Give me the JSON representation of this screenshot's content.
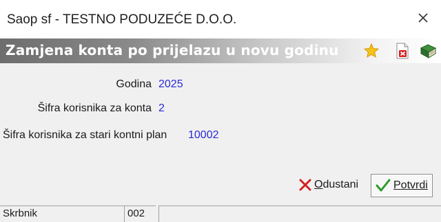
{
  "window": {
    "title": "Saop sf - TESTNO PODUZEĆE D.O.O.",
    "close_icon": "close-icon"
  },
  "header": {
    "title": "Zamjena konta po prijelazu u novu godinu",
    "icons": [
      "star-icon",
      "delete-document-icon",
      "book-icon"
    ]
  },
  "form": {
    "fields": [
      {
        "label": "Godina",
        "value": "2025"
      },
      {
        "label": "Šifra korisnika za konta",
        "value": "2"
      },
      {
        "label": "Šifra korisnika za stari kontni plan",
        "value": "10002"
      }
    ]
  },
  "buttons": {
    "cancel": {
      "mnemonic": "O",
      "rest": "dustani",
      "icon": "x-icon"
    },
    "confirm": {
      "mnemonic": "P",
      "rest": "otvrdi",
      "icon": "checkmark-icon"
    }
  },
  "statusbar": {
    "user": "Skrbnik",
    "code": "002",
    "info": ""
  },
  "colors": {
    "value_text": "#2a2ad8",
    "cancel_icon": "#d42020",
    "confirm_icon": "#2a9a2a"
  }
}
